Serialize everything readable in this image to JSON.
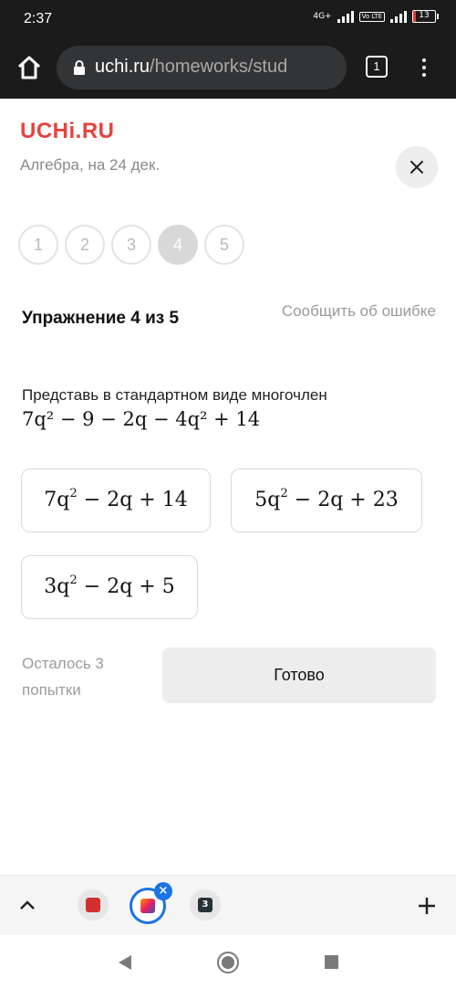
{
  "status_bar": {
    "time": "2:37",
    "network": "4G+",
    "volte": "Vo LTE",
    "battery_text": "13",
    "battery_level": 0.13
  },
  "browser": {
    "url_host": "uchi.ru",
    "url_path": "/homeworks/stud",
    "tab_count": "1",
    "icons": [
      "home-icon",
      "lock-icon",
      "menu-dots-icon"
    ]
  },
  "page": {
    "logo": "UCHi.RU",
    "subtitle": "Алгебра, на 24 дек.",
    "steps": [
      "1",
      "2",
      "3",
      "4",
      "5"
    ],
    "active_step": "4",
    "exercise_title": "Упражнение 4 из 5",
    "report_link": "Сообщить об ошибке",
    "task_text": "Представь в стандартном виде многочлен",
    "task_expression": "7q² − 9 − 2q − 4q² + 14",
    "options": [
      {
        "coef": "7q",
        "exp": "2",
        "rest": " − 2q + 14"
      },
      {
        "coef": "5q",
        "exp": "2",
        "rest": " − 2q + 23"
      },
      {
        "coef": "3q",
        "exp": "2",
        "rest": " − 2q + 5"
      }
    ],
    "attempts_text": "Осталось 3 попытки",
    "ready_button": "Готово"
  },
  "colors": {
    "brand": "#e5433d",
    "active_tab_ring": "#1a73e8"
  },
  "bottom": {
    "tab_badge": "3",
    "close_badge": "×"
  }
}
